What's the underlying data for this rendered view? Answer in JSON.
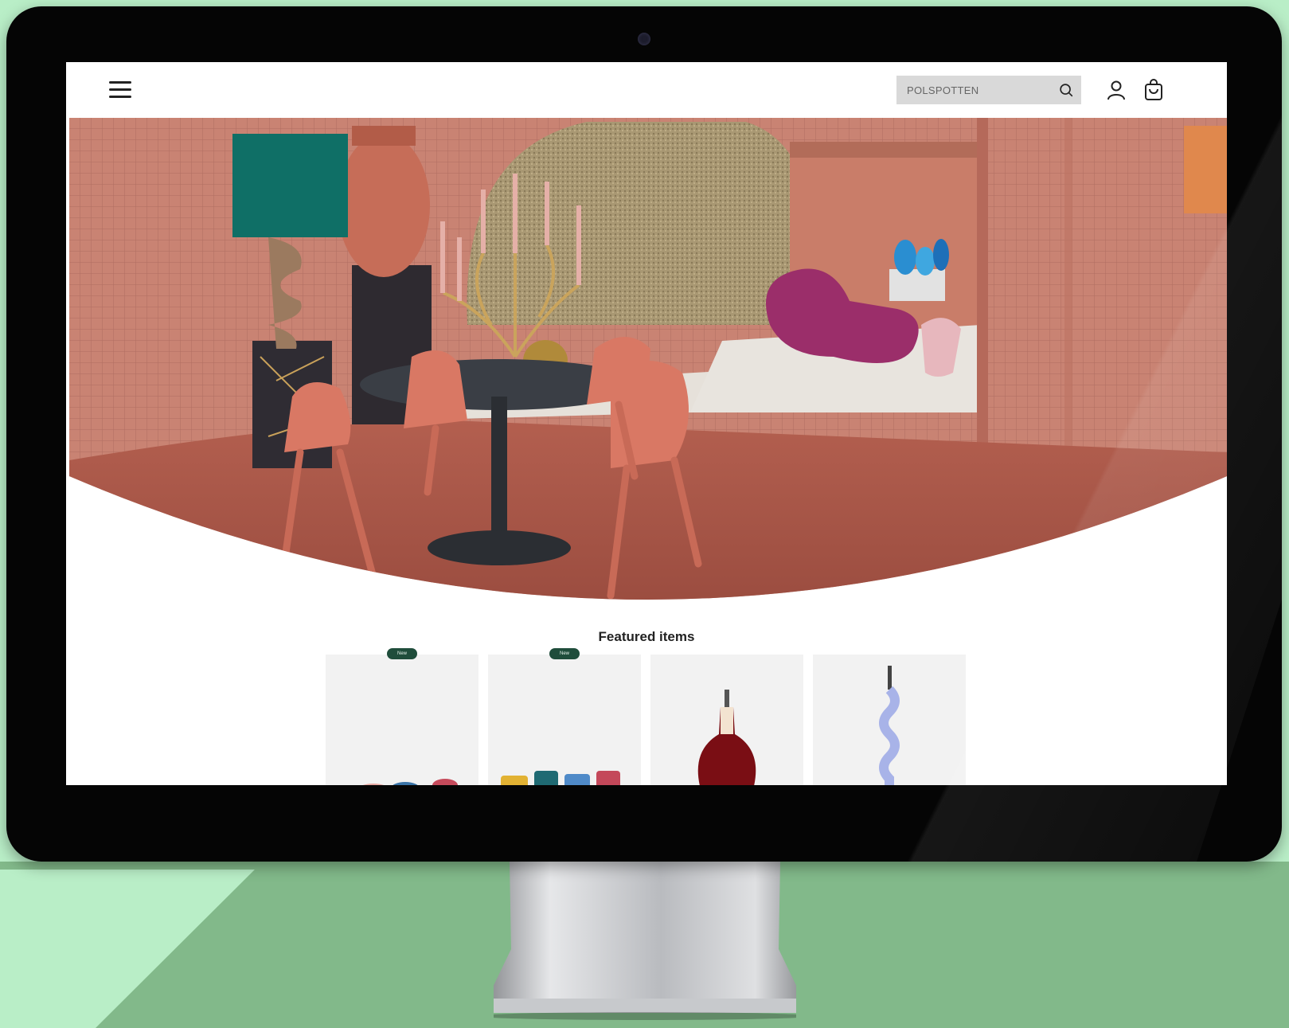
{
  "header": {
    "search_placeholder": "POLSPOTTEN",
    "icons": [
      "menu-icon",
      "search-icon",
      "user-icon",
      "cart-icon"
    ]
  },
  "hero": {
    "image": "interior-dining-scene",
    "colors": {
      "terracotta": "#b86a58",
      "wall": "#c98373",
      "floor": "#a9574a"
    }
  },
  "featured": {
    "title": "Featured items",
    "items": [
      {
        "badge": "New",
        "image": "colorful-cups"
      },
      {
        "badge": "New",
        "image": "colorful-cups-2"
      },
      {
        "badge": "",
        "image": "red-vase-lamp"
      },
      {
        "badge": "",
        "image": "twisted-lamp"
      }
    ]
  },
  "colors": {
    "background_light": "#b9eec7",
    "background_dark": "#82b98a",
    "badge": "#1f4d3b"
  }
}
